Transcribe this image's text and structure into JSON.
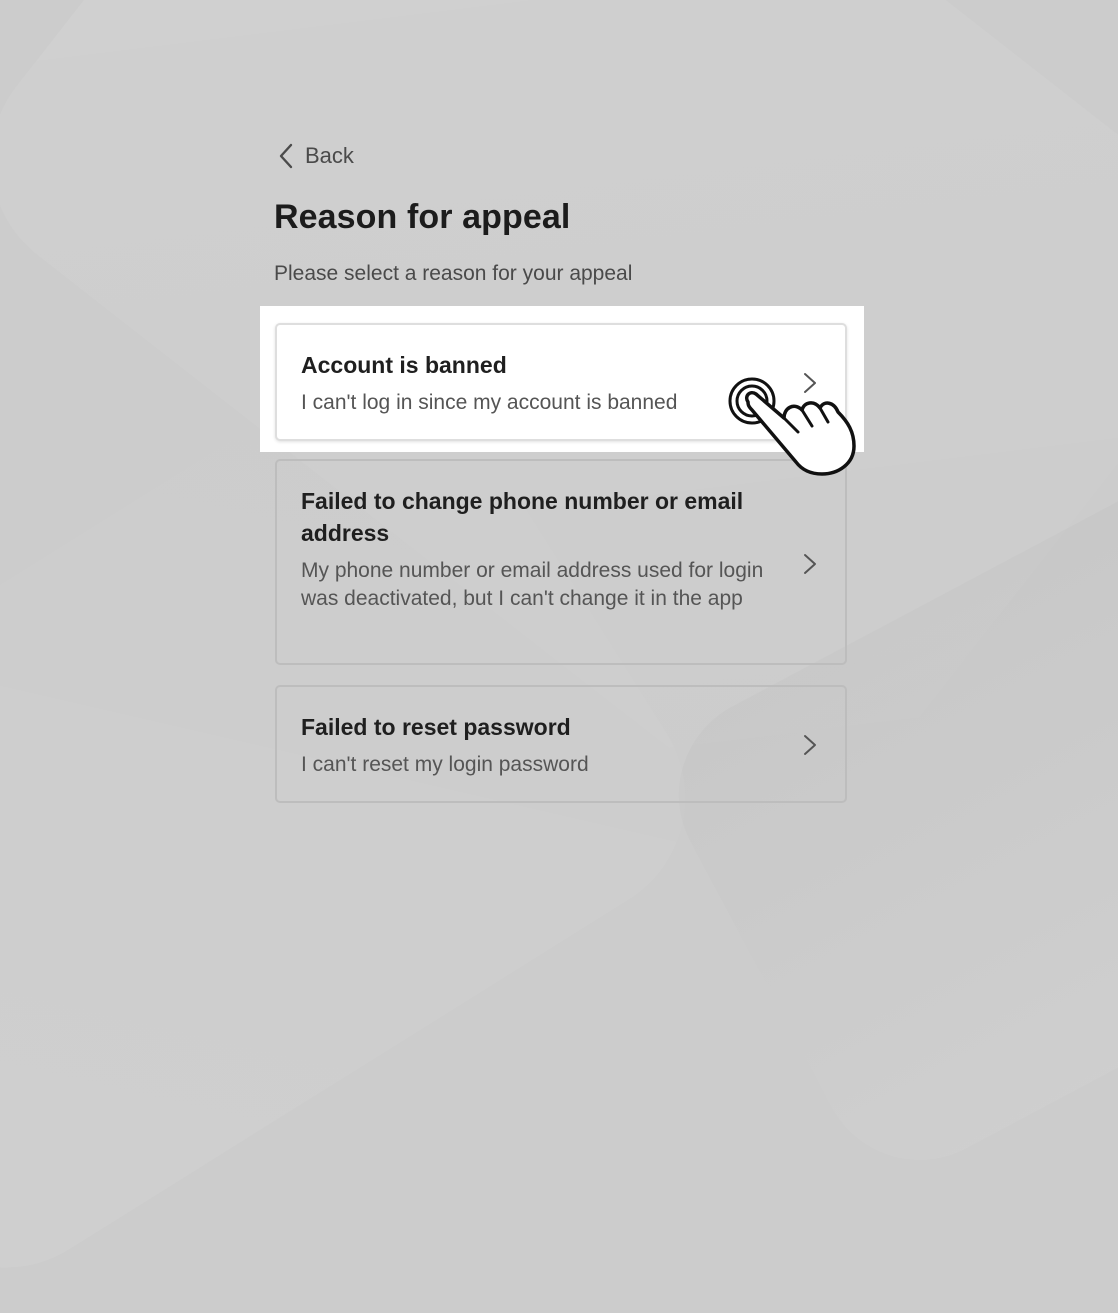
{
  "nav": {
    "back_label": "Back"
  },
  "header": {
    "title": "Reason for appeal",
    "subtitle": "Please select a reason for your appeal"
  },
  "reasons": [
    {
      "title": "Account is banned",
      "description": "I can't log in since my account is banned"
    },
    {
      "title": "Failed to change phone number or email address",
      "description": "My phone number or email address used for login was deactivated, but I can't change it in the app"
    },
    {
      "title": "Failed to reset password",
      "description": "I can't reset my login password"
    }
  ],
  "icons": {
    "back": "chevron-left-icon",
    "row_arrow": "chevron-right-icon",
    "pointer": "hand-pointer-icon"
  },
  "colors": {
    "background": "#cccccc",
    "card_active": "#ffffff",
    "title_text": "#1c1c1c",
    "secondary_text": "#4a4a4a"
  }
}
